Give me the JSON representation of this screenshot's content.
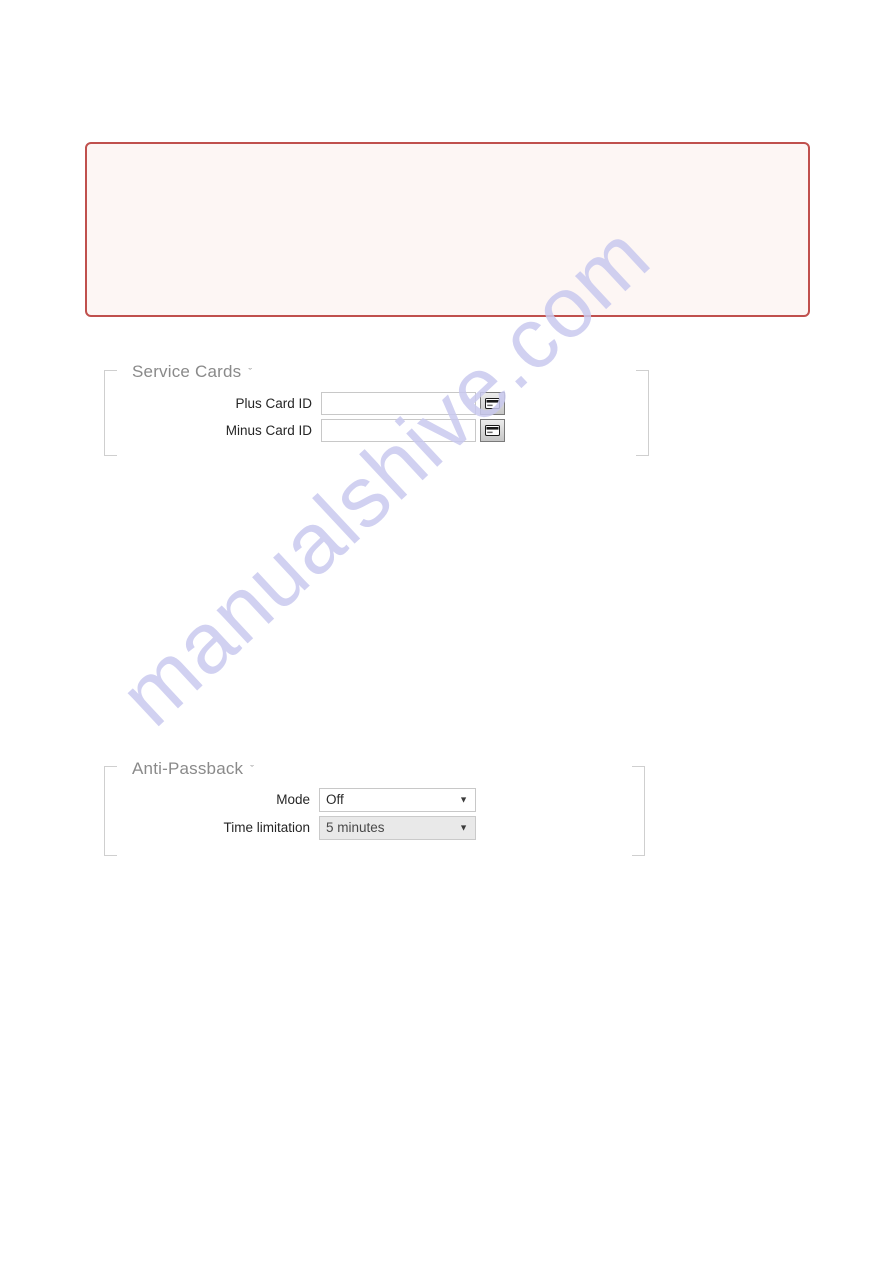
{
  "page": {
    "background_color": "#ffffff",
    "watermark": "manualshive.com",
    "watermark_color": "#c9c9ef"
  },
  "note_box": {
    "text": "",
    "border_color": "#c0504d",
    "background_color": "#fdf6f4"
  },
  "sections": [
    {
      "id": "service-cards",
      "title": "Service Cards",
      "chevron": "ˇ",
      "fields": [
        {
          "label": "Plus Card ID",
          "type": "text",
          "value": "",
          "placeholder": "",
          "button_icon": "card-reader-icon"
        },
        {
          "label": "Minus Card ID",
          "type": "text",
          "value": "",
          "placeholder": "",
          "button_icon": "card-reader-icon"
        }
      ]
    },
    {
      "id": "anti-passback",
      "title": "Anti-Passback",
      "chevron": "ˇ",
      "fields": [
        {
          "label": "Mode",
          "type": "select",
          "value": "Off",
          "disabled": false,
          "arrow": "▼"
        },
        {
          "label": "Time limitation",
          "type": "select",
          "value": "5 minutes",
          "disabled": true,
          "arrow": "▼"
        }
      ]
    }
  ]
}
